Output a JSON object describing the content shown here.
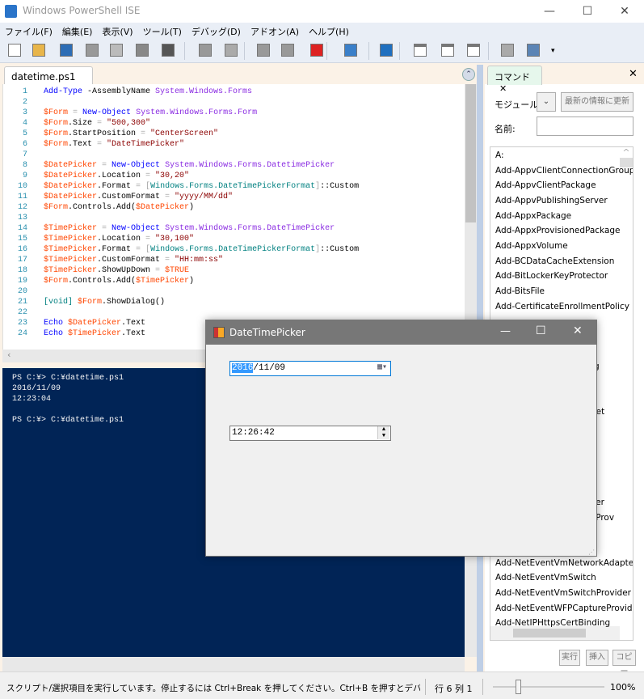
{
  "window": {
    "title": "Windows PowerShell ISE",
    "min": "—",
    "max": "☐",
    "close": "✕"
  },
  "menu": [
    "ファイル(F)",
    "編集(E)",
    "表示(V)",
    "ツール(T)",
    "デバッグ(D)",
    "アドオン(A)",
    "ヘルプ(H)"
  ],
  "toolbar": [
    "new",
    "open",
    "save",
    "cut",
    "copy",
    "paste",
    "clear-console",
    "undo",
    "redo",
    "run",
    "run-selection",
    "stop",
    "remote-powershell",
    "start-powershell",
    "layout-script-top",
    "layout-script-right",
    "layout-script-max",
    "show-script-pane",
    "show-command-addon"
  ],
  "editor": {
    "tab": "datetime.ps1",
    "tab_close": "✕",
    "lines": [
      [
        [
          "Add-Type",
          "cmd"
        ],
        [
          " -AssemblyName ",
          "plain"
        ],
        [
          "System.Windows.Forms",
          "type"
        ]
      ],
      [],
      [
        [
          "$Form",
          "var"
        ],
        [
          " = ",
          "op"
        ],
        [
          "New-Object",
          "cmd"
        ],
        [
          " ",
          "plain"
        ],
        [
          "System.Windows.Forms.Form",
          "type"
        ]
      ],
      [
        [
          "$Form",
          "var"
        ],
        [
          ".Size",
          "plain"
        ],
        [
          " = ",
          "op"
        ],
        [
          "\"500,300\"",
          "str"
        ]
      ],
      [
        [
          "$Form",
          "var"
        ],
        [
          ".StartPosition",
          "plain"
        ],
        [
          " = ",
          "op"
        ],
        [
          "\"CenterScreen\"",
          "str"
        ]
      ],
      [
        [
          "$Form",
          "var"
        ],
        [
          ".Text",
          "plain"
        ],
        [
          " = ",
          "op"
        ],
        [
          "\"DateTimePicker\"",
          "str"
        ]
      ],
      [],
      [
        [
          "$DatePicker",
          "var"
        ],
        [
          " = ",
          "op"
        ],
        [
          "New-Object",
          "cmd"
        ],
        [
          " ",
          "plain"
        ],
        [
          "System.Windows.Forms.DatetimePicker",
          "type"
        ]
      ],
      [
        [
          "$DatePicker",
          "var"
        ],
        [
          ".Location",
          "plain"
        ],
        [
          " = ",
          "op"
        ],
        [
          "\"30,20\"",
          "str"
        ]
      ],
      [
        [
          "$DatePicker",
          "var"
        ],
        [
          ".Format",
          "plain"
        ],
        [
          " = ",
          "op"
        ],
        [
          "[",
          "op"
        ],
        [
          "Windows.Forms.DateTimePickerFormat",
          "tn"
        ],
        [
          "]",
          "op"
        ],
        [
          "::Custom",
          "plain"
        ]
      ],
      [
        [
          "$DatePicker",
          "var"
        ],
        [
          ".CustomFormat",
          "plain"
        ],
        [
          " = ",
          "op"
        ],
        [
          "\"yyyy/MM/dd\"",
          "str"
        ]
      ],
      [
        [
          "$Form",
          "var"
        ],
        [
          ".Controls.Add(",
          "plain"
        ],
        [
          "$DatePicker",
          "var"
        ],
        [
          ")",
          "plain"
        ]
      ],
      [],
      [
        [
          "$TimePicker",
          "var"
        ],
        [
          " = ",
          "op"
        ],
        [
          "New-Object",
          "cmd"
        ],
        [
          " ",
          "plain"
        ],
        [
          "System.Windows.Forms.DateTimePicker",
          "type"
        ]
      ],
      [
        [
          "$TimePicker",
          "var"
        ],
        [
          ".Location",
          "plain"
        ],
        [
          " = ",
          "op"
        ],
        [
          "\"30,100\"",
          "str"
        ]
      ],
      [
        [
          "$TimePicker",
          "var"
        ],
        [
          ".Format",
          "plain"
        ],
        [
          " = ",
          "op"
        ],
        [
          "[",
          "op"
        ],
        [
          "Windows.Forms.DateTimePickerFormat",
          "tn"
        ],
        [
          "]",
          "op"
        ],
        [
          "::Custom",
          "plain"
        ]
      ],
      [
        [
          "$TimePicker",
          "var"
        ],
        [
          ".CustomFormat",
          "plain"
        ],
        [
          " = ",
          "op"
        ],
        [
          "\"HH:mm:ss\"",
          "str"
        ]
      ],
      [
        [
          "$TimePicker",
          "var"
        ],
        [
          ".ShowUpDown",
          "plain"
        ],
        [
          " = ",
          "op"
        ],
        [
          "$TRUE",
          "var"
        ]
      ],
      [
        [
          "$Form",
          "var"
        ],
        [
          ".Controls.Add(",
          "plain"
        ],
        [
          "$TimePicker",
          "var"
        ],
        [
          ")",
          "plain"
        ]
      ],
      [],
      [
        [
          "[void]",
          "tn"
        ],
        [
          " ",
          "plain"
        ],
        [
          "$Form",
          "var"
        ],
        [
          ".ShowDialog()",
          "plain"
        ]
      ],
      [],
      [
        [
          "Echo",
          "cmd"
        ],
        [
          " ",
          "plain"
        ],
        [
          "$DatePicker",
          "var"
        ],
        [
          ".Text",
          "plain"
        ]
      ],
      [
        [
          "Echo",
          "cmd"
        ],
        [
          " ",
          "plain"
        ],
        [
          "$TimePicker",
          "var"
        ],
        [
          ".Text",
          "plain"
        ]
      ]
    ]
  },
  "console": {
    "text": "PS C:¥> C:¥datetime.ps1\n2016/11/09\n12:23:04\n\nPS C:¥> C:¥datetime.ps1"
  },
  "commands": {
    "tab": "コマンド",
    "tab_close": "✕",
    "panel_close": "✕",
    "module_label": "モジュール:",
    "refresh": "最新の情報に更新",
    "name_label": "名前:",
    "name_value": "",
    "items": [
      "A:",
      "Add-AppvClientConnectionGroup",
      "Add-AppvClientPackage",
      "Add-AppvPublishingServer",
      "Add-AppxPackage",
      "Add-AppxProvisionedPackage",
      "Add-AppxVolume",
      "Add-BCDataCacheExtension",
      "Add-BitLockerKeyProtector",
      "Add-BitsFile",
      "Add-CertificateEnrollmentPolicy"
    ],
    "partial_items": [
      {
        "row": 14,
        "text": "g"
      },
      {
        "row": 17,
        "text": "Set"
      },
      {
        "row": 23,
        "text": "apter"
      },
      {
        "row": 24,
        "text": "ureProv"
      }
    ],
    "bottom_items": [
      "Add-NetEventVmNetworkAdapter",
      "Add-NetEventVmSwitch",
      "Add-NetEventVmSwitchProvider",
      "Add-NetEventWFPCaptureProvider",
      "Add-NetIPHttpsCertBinding"
    ],
    "run": "実行",
    "insert": "挿入",
    "copy": "コピー"
  },
  "status": {
    "message": "スクリプト/選択項目を実行しています。停止するには Ctrl+Break を押してください。Ctrl+B を押すとデバッガーに",
    "position": "行 6  列 1",
    "zoom": "100%",
    "zoom_value": 100
  },
  "dialog": {
    "title": "DateTimePicker",
    "date_selected": "2016",
    "date_rest": "/11/09",
    "time": "12:26:42",
    "min": "—",
    "max": "☐",
    "close": "✕"
  }
}
